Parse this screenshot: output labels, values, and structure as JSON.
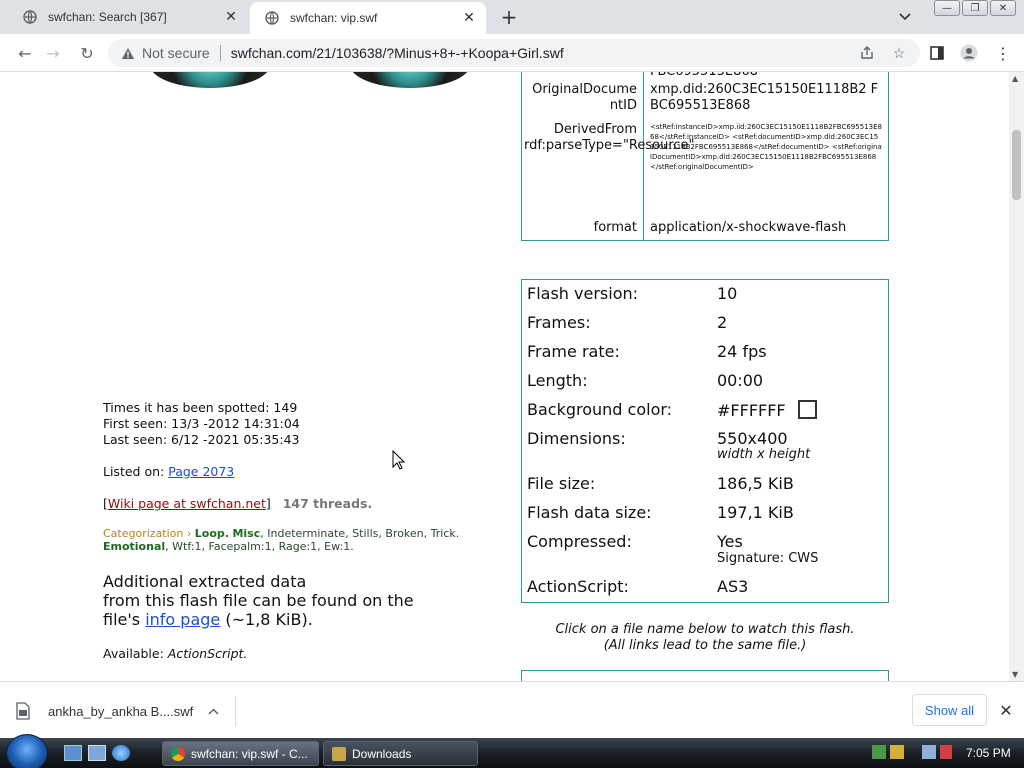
{
  "browser": {
    "tabs": [
      {
        "title": "swfchan: Search [367]",
        "active": false
      },
      {
        "title": "swfchan: vip.swf",
        "active": true
      }
    ],
    "security_label": "Not secure",
    "url": "swfchan.com/21/103638/?Minus+8+-+Koopa+Girl.swf"
  },
  "page": {
    "spotted": "Times it has been spotted: 149",
    "first_seen": "First seen: 13/3 -2012 14:31:04",
    "last_seen": "Last seen: 6/12 -2021 05:35:43",
    "listed_on_label": "Listed on:",
    "listed_on_link": "Page 2073",
    "wiki_open": "[",
    "wiki_link": "Wiki page at swfchan.net",
    "wiki_close": "]",
    "threads": "147 threads.",
    "cat_label": "Categorization ›",
    "cat_loop": "Loop",
    "cat_misc": "Misc",
    "cat_rest": ", Indeterminate, Stills, Broken, Trick.",
    "cat_emotional": "Emotional",
    "cat_emotions": ", Wtf:1, Facepalm:1, Rage:1, Ew:1.",
    "extracted_1": "Additional extracted data",
    "extracted_2": "from this flash file can be found on the",
    "extracted_3a": "file's",
    "extracted_link": "info page",
    "extracted_3b": "(~1,8 KiB).",
    "available_label": "Available:",
    "available_value": "ActionScript."
  },
  "xmp": {
    "top_val": "FBC695513E868",
    "rows": [
      {
        "key": "OriginalDocumentID",
        "value": "xmp.did:260C3EC15150E1118B2 FBC695513E868"
      },
      {
        "key": "DerivedFrom rdf:parseType=\"Resource\"",
        "value": "<stRef:instanceID>xmp.iid:260C3EC15150E1118B2FBC695513E868</stRef:instanceID> <stRef:documentID>xmp.did:260C3EC15150E1118B2FBC695513E868</stRef:documentID> <stRef:originalDocumentID>xmp.did:260C3EC15150E1118B2FBC695513E868</stRef:originalDocumentID>"
      },
      {
        "key": "format",
        "value": "application/x-shockwave-flash"
      }
    ]
  },
  "flash": {
    "version_label": "Flash version:",
    "version": "10",
    "frames_label": "Frames:",
    "frames": "2",
    "rate_label": "Frame rate:",
    "rate": "24 fps",
    "length_label": "Length:",
    "length": "00:00",
    "bg_label": "Background color:",
    "bg": "#FFFFFF",
    "dim_label": "Dimensions:",
    "dim": "550x400",
    "dim_sub": "width x height",
    "size_label": "File size:",
    "size": "186,5 KiB",
    "data_label": "Flash data size:",
    "data": "197,1 KiB",
    "comp_label": "Compressed:",
    "comp": "Yes",
    "comp_sub": "Signature: CWS",
    "as_label": "ActionScript:",
    "as": "AS3"
  },
  "click_note_1": "Click on a file name below to watch this flash.",
  "click_note_2": "(All links lead to the same file.)",
  "downloads": {
    "file": "ankha_by_ankha B....swf",
    "show_all": "Show all"
  },
  "taskbar": {
    "task_active": "swfchan: vip.swf - C...",
    "task_inactive": "Downloads",
    "clock": "7:05 PM"
  },
  "colors": {
    "accent": "#2b9a9a",
    "link": "#1a4fd0",
    "wiki": "#8b1010"
  }
}
